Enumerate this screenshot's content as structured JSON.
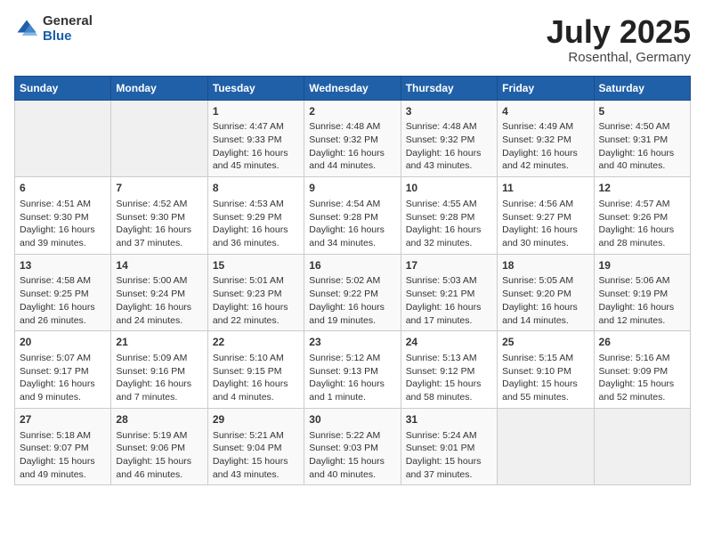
{
  "header": {
    "logo_general": "General",
    "logo_blue": "Blue",
    "title": "July 2025",
    "location": "Rosenthal, Germany"
  },
  "calendar": {
    "days_of_week": [
      "Sunday",
      "Monday",
      "Tuesday",
      "Wednesday",
      "Thursday",
      "Friday",
      "Saturday"
    ],
    "weeks": [
      [
        {
          "day": "",
          "empty": true
        },
        {
          "day": "",
          "empty": true
        },
        {
          "day": "1",
          "sunrise": "Sunrise: 4:47 AM",
          "sunset": "Sunset: 9:33 PM",
          "daylight": "Daylight: 16 hours and 45 minutes."
        },
        {
          "day": "2",
          "sunrise": "Sunrise: 4:48 AM",
          "sunset": "Sunset: 9:32 PM",
          "daylight": "Daylight: 16 hours and 44 minutes."
        },
        {
          "day": "3",
          "sunrise": "Sunrise: 4:48 AM",
          "sunset": "Sunset: 9:32 PM",
          "daylight": "Daylight: 16 hours and 43 minutes."
        },
        {
          "day": "4",
          "sunrise": "Sunrise: 4:49 AM",
          "sunset": "Sunset: 9:32 PM",
          "daylight": "Daylight: 16 hours and 42 minutes."
        },
        {
          "day": "5",
          "sunrise": "Sunrise: 4:50 AM",
          "sunset": "Sunset: 9:31 PM",
          "daylight": "Daylight: 16 hours and 40 minutes."
        }
      ],
      [
        {
          "day": "6",
          "sunrise": "Sunrise: 4:51 AM",
          "sunset": "Sunset: 9:30 PM",
          "daylight": "Daylight: 16 hours and 39 minutes."
        },
        {
          "day": "7",
          "sunrise": "Sunrise: 4:52 AM",
          "sunset": "Sunset: 9:30 PM",
          "daylight": "Daylight: 16 hours and 37 minutes."
        },
        {
          "day": "8",
          "sunrise": "Sunrise: 4:53 AM",
          "sunset": "Sunset: 9:29 PM",
          "daylight": "Daylight: 16 hours and 36 minutes."
        },
        {
          "day": "9",
          "sunrise": "Sunrise: 4:54 AM",
          "sunset": "Sunset: 9:28 PM",
          "daylight": "Daylight: 16 hours and 34 minutes."
        },
        {
          "day": "10",
          "sunrise": "Sunrise: 4:55 AM",
          "sunset": "Sunset: 9:28 PM",
          "daylight": "Daylight: 16 hours and 32 minutes."
        },
        {
          "day": "11",
          "sunrise": "Sunrise: 4:56 AM",
          "sunset": "Sunset: 9:27 PM",
          "daylight": "Daylight: 16 hours and 30 minutes."
        },
        {
          "day": "12",
          "sunrise": "Sunrise: 4:57 AM",
          "sunset": "Sunset: 9:26 PM",
          "daylight": "Daylight: 16 hours and 28 minutes."
        }
      ],
      [
        {
          "day": "13",
          "sunrise": "Sunrise: 4:58 AM",
          "sunset": "Sunset: 9:25 PM",
          "daylight": "Daylight: 16 hours and 26 minutes."
        },
        {
          "day": "14",
          "sunrise": "Sunrise: 5:00 AM",
          "sunset": "Sunset: 9:24 PM",
          "daylight": "Daylight: 16 hours and 24 minutes."
        },
        {
          "day": "15",
          "sunrise": "Sunrise: 5:01 AM",
          "sunset": "Sunset: 9:23 PM",
          "daylight": "Daylight: 16 hours and 22 minutes."
        },
        {
          "day": "16",
          "sunrise": "Sunrise: 5:02 AM",
          "sunset": "Sunset: 9:22 PM",
          "daylight": "Daylight: 16 hours and 19 minutes."
        },
        {
          "day": "17",
          "sunrise": "Sunrise: 5:03 AM",
          "sunset": "Sunset: 9:21 PM",
          "daylight": "Daylight: 16 hours and 17 minutes."
        },
        {
          "day": "18",
          "sunrise": "Sunrise: 5:05 AM",
          "sunset": "Sunset: 9:20 PM",
          "daylight": "Daylight: 16 hours and 14 minutes."
        },
        {
          "day": "19",
          "sunrise": "Sunrise: 5:06 AM",
          "sunset": "Sunset: 9:19 PM",
          "daylight": "Daylight: 16 hours and 12 minutes."
        }
      ],
      [
        {
          "day": "20",
          "sunrise": "Sunrise: 5:07 AM",
          "sunset": "Sunset: 9:17 PM",
          "daylight": "Daylight: 16 hours and 9 minutes."
        },
        {
          "day": "21",
          "sunrise": "Sunrise: 5:09 AM",
          "sunset": "Sunset: 9:16 PM",
          "daylight": "Daylight: 16 hours and 7 minutes."
        },
        {
          "day": "22",
          "sunrise": "Sunrise: 5:10 AM",
          "sunset": "Sunset: 9:15 PM",
          "daylight": "Daylight: 16 hours and 4 minutes."
        },
        {
          "day": "23",
          "sunrise": "Sunrise: 5:12 AM",
          "sunset": "Sunset: 9:13 PM",
          "daylight": "Daylight: 16 hours and 1 minute."
        },
        {
          "day": "24",
          "sunrise": "Sunrise: 5:13 AM",
          "sunset": "Sunset: 9:12 PM",
          "daylight": "Daylight: 15 hours and 58 minutes."
        },
        {
          "day": "25",
          "sunrise": "Sunrise: 5:15 AM",
          "sunset": "Sunset: 9:10 PM",
          "daylight": "Daylight: 15 hours and 55 minutes."
        },
        {
          "day": "26",
          "sunrise": "Sunrise: 5:16 AM",
          "sunset": "Sunset: 9:09 PM",
          "daylight": "Daylight: 15 hours and 52 minutes."
        }
      ],
      [
        {
          "day": "27",
          "sunrise": "Sunrise: 5:18 AM",
          "sunset": "Sunset: 9:07 PM",
          "daylight": "Daylight: 15 hours and 49 minutes."
        },
        {
          "day": "28",
          "sunrise": "Sunrise: 5:19 AM",
          "sunset": "Sunset: 9:06 PM",
          "daylight": "Daylight: 15 hours and 46 minutes."
        },
        {
          "day": "29",
          "sunrise": "Sunrise: 5:21 AM",
          "sunset": "Sunset: 9:04 PM",
          "daylight": "Daylight: 15 hours and 43 minutes."
        },
        {
          "day": "30",
          "sunrise": "Sunrise: 5:22 AM",
          "sunset": "Sunset: 9:03 PM",
          "daylight": "Daylight: 15 hours and 40 minutes."
        },
        {
          "day": "31",
          "sunrise": "Sunrise: 5:24 AM",
          "sunset": "Sunset: 9:01 PM",
          "daylight": "Daylight: 15 hours and 37 minutes."
        },
        {
          "day": "",
          "empty": true
        },
        {
          "day": "",
          "empty": true
        }
      ]
    ]
  }
}
